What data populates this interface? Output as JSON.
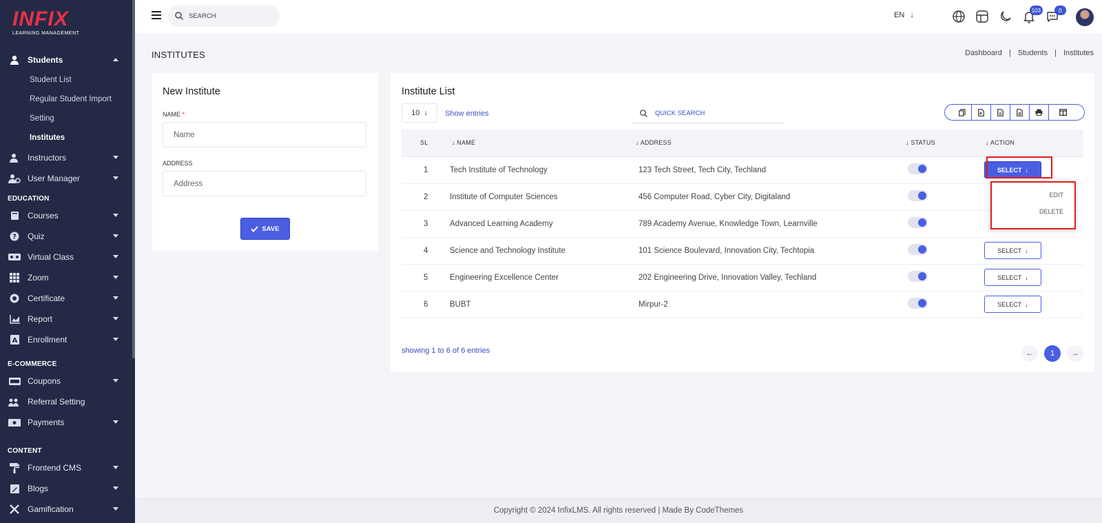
{
  "brand": {
    "logo_main": "INFIX",
    "logo_sub": "LEARNING MANAGEMENT",
    "accent": "#4a5ee2",
    "sidebar_bg": "#242a45"
  },
  "sidebar": {
    "students": {
      "label": "Students",
      "icon": "user-icon",
      "sub": [
        "Student List",
        "Regular Student Import",
        "Setting",
        "Institutes"
      ]
    },
    "items1": [
      {
        "label": "Instructors",
        "icon": "instructor-icon"
      },
      {
        "label": "User Manager",
        "icon": "user-manager-icon"
      }
    ],
    "section_education": "EDUCATION",
    "education": [
      {
        "label": "Courses",
        "icon": "book-icon"
      },
      {
        "label": "Quiz",
        "icon": "question-icon"
      },
      {
        "label": "Virtual Class",
        "icon": "vr-icon"
      },
      {
        "label": "Zoom",
        "icon": "grid-icon"
      },
      {
        "label": "Certificate",
        "icon": "certificate-icon"
      },
      {
        "label": "Report",
        "icon": "chart-icon"
      },
      {
        "label": "Enrollment",
        "icon": "enrollment-icon"
      }
    ],
    "section_ecommerce": "E-COMMERCE",
    "ecommerce": [
      {
        "label": "Coupons",
        "icon": "coupon-icon"
      },
      {
        "label": "Referral Setting",
        "icon": "referral-icon"
      },
      {
        "label": "Payments",
        "icon": "payment-icon"
      }
    ],
    "section_content": "CONTENT",
    "content": [
      {
        "label": "Frontend CMS",
        "icon": "paint-roller-icon"
      },
      {
        "label": "Blogs",
        "icon": "blog-icon"
      },
      {
        "label": "Gamification",
        "icon": "gamification-icon"
      }
    ]
  },
  "topbar": {
    "search_placeholder": "SEARCH",
    "lang": "EN",
    "notifications": "103",
    "messages": "0"
  },
  "page": {
    "title": "INSTITUTES",
    "breadcrumb": [
      "Dashboard",
      "Students",
      "Institutes"
    ],
    "sep": "|"
  },
  "new_institute": {
    "title": "New Institute",
    "name_label": "NAME",
    "required": "*",
    "name_placeholder": "Name",
    "address_label": "ADDRESS",
    "address_placeholder": "Address",
    "save": "SAVE"
  },
  "list": {
    "title": "Institute List",
    "entries": "10",
    "show_entries": "Show entries",
    "quick_search": "QUICK SEARCH",
    "headers": {
      "sl": "SL",
      "name": "NAME",
      "address": "ADDRESS",
      "status": "STATUS",
      "action": "ACTION"
    },
    "rows": [
      {
        "sl": "1",
        "name": "Tech Institute of Technology",
        "address": "123 Tech Street, Tech City, Techland"
      },
      {
        "sl": "2",
        "name": "Institute of Computer Sciences",
        "address": "456 Computer Road, Cyber City, Digitaland"
      },
      {
        "sl": "3",
        "name": "Advanced Learning Academy",
        "address": "789 Academy Avenue, Knowledge Town, Learnville"
      },
      {
        "sl": "4",
        "name": "Science and Technology Institute",
        "address": "101 Science Boulevard, Innovation City, Techtopia"
      },
      {
        "sl": "5",
        "name": "Engineering Excellence Center",
        "address": "202 Engineering Drive, Innovation Valley, Techland"
      },
      {
        "sl": "6",
        "name": "BUBT",
        "address": "Mirpur-2"
      }
    ],
    "select_label": "SELECT",
    "dropdown": {
      "edit": "EDIT",
      "delete": "DELETE"
    },
    "showing": "showing 1 to 6 of 6 entries",
    "current_page": "1"
  },
  "footer": "Copyright © 2024 InfixLMS. All rights reserved | Made By CodeThemes"
}
